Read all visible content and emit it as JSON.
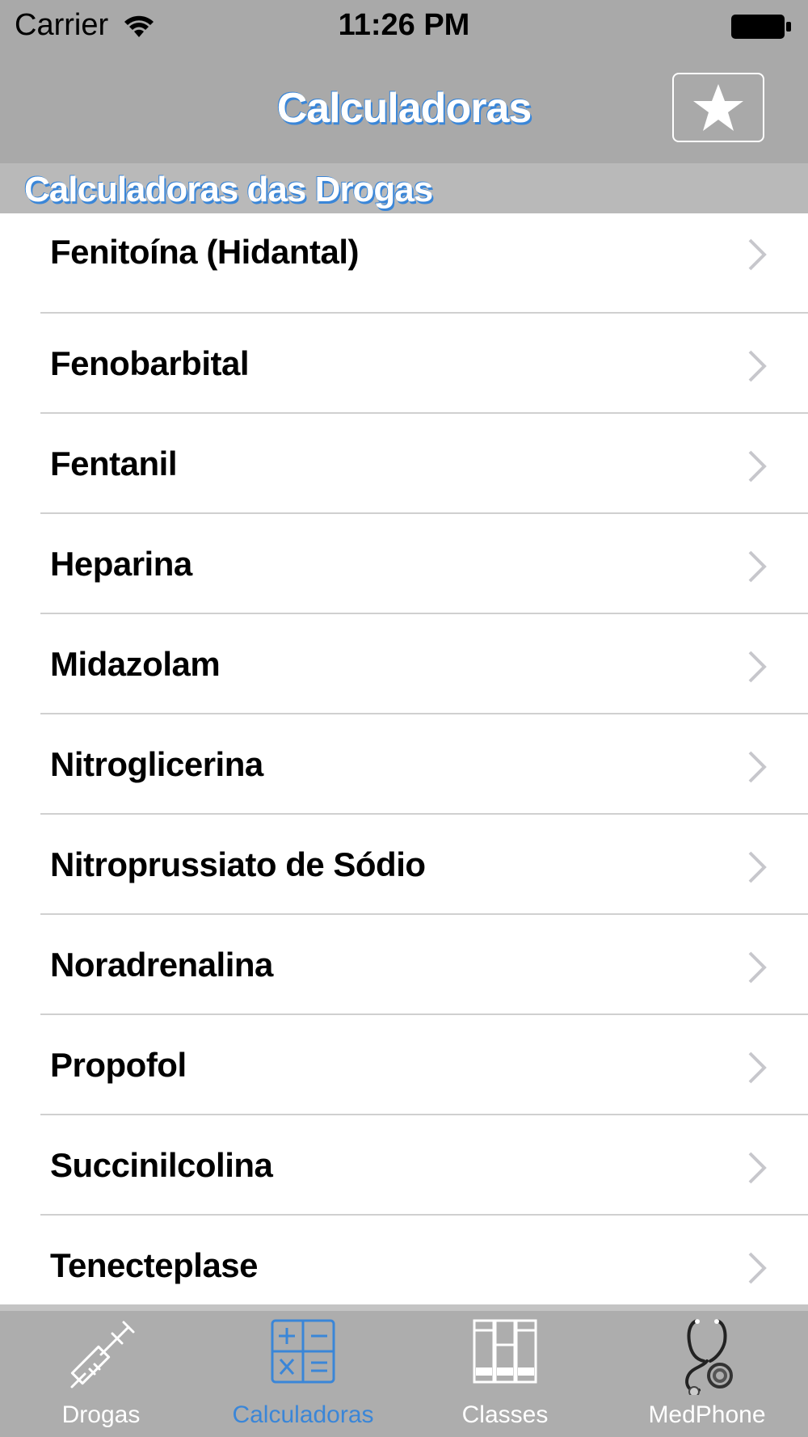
{
  "status_bar": {
    "carrier": "Carrier",
    "time": "11:26 PM"
  },
  "nav": {
    "title": "Calculadoras",
    "favorite_icon": "star-icon"
  },
  "section": {
    "title": "Calculadoras das Drogas"
  },
  "items": [
    {
      "label": "Fenitoína (Hidantal)"
    },
    {
      "label": "Fenobarbital"
    },
    {
      "label": "Fentanil"
    },
    {
      "label": "Heparina"
    },
    {
      "label": "Midazolam"
    },
    {
      "label": "Nitroglicerina"
    },
    {
      "label": "Nitroprussiato de Sódio"
    },
    {
      "label": "Noradrenalina"
    },
    {
      "label": "Propofol"
    },
    {
      "label": "Succinilcolina"
    },
    {
      "label": "Tenecteplase"
    }
  ],
  "tabs": [
    {
      "label": "Drogas",
      "icon": "syringe-icon",
      "active": false
    },
    {
      "label": "Calculadoras",
      "icon": "calculator-icon",
      "active": true
    },
    {
      "label": "Classes",
      "icon": "books-icon",
      "active": false
    },
    {
      "label": "MedPhone",
      "icon": "stethoscope-icon",
      "active": false
    }
  ],
  "colors": {
    "accent": "#3a86d8",
    "bar_background": "#a9a9a9"
  }
}
